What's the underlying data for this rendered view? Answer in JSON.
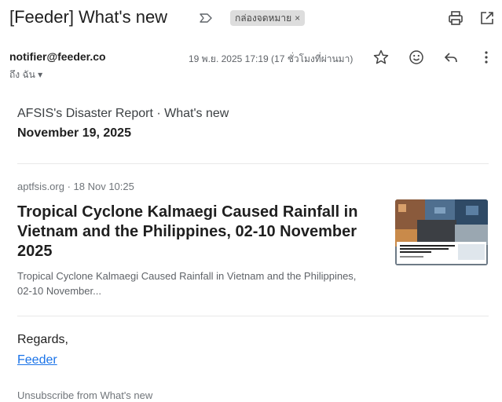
{
  "email": {
    "subject": "[Feeder] What's new",
    "label_chip": "กล่องจดหมาย",
    "label_close": "×",
    "sender": "notifier@feeder.co",
    "to_me": "ถึง ฉัน ▾",
    "date": "19 พ.ย. 2025 17:19 (17 ชั่วโมงที่ผ่านมา)"
  },
  "body": {
    "report_title": "AFSIS's Disaster Report · What's new",
    "report_date": "November 19, 2025",
    "article": {
      "meta": "aptfsis.org · 18 Nov 10:25",
      "title": "Tropical Cyclone Kalmaegi Caused Rainfall in Vietnam and the Philippines, 02-10 November 2025",
      "description": "Tropical Cyclone Kalmaegi Caused Rainfall in Vietnam and the Philippines, 02-10 November..."
    },
    "regards": "Regards,",
    "signature_link": "Feeder",
    "unsubscribe": "Unsubscribe from What's new"
  },
  "icons": {
    "importance": "importance-marker-icon",
    "print": "print-icon",
    "open_new_window": "open-in-new-window-icon",
    "star": "star-icon",
    "emoji": "emoji-react-icon",
    "reply": "reply-icon",
    "more": "more-vertical-icon"
  },
  "colors": {
    "link": "#1a73e8",
    "muted": "#5f6368",
    "chip_bg": "#dddddd"
  }
}
